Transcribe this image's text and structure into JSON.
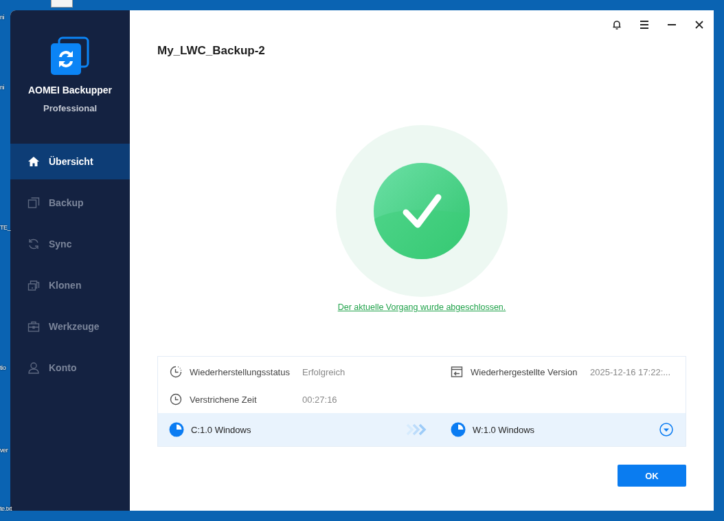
{
  "desktop_labels": [
    "ni",
    "ni",
    "TE_",
    "tio",
    "ver",
    "te.txt"
  ],
  "app": {
    "name": "AOMEI Backupper",
    "edition": "Professional"
  },
  "nav": [
    {
      "kind": "home",
      "label": "Übersicht",
      "selected": true
    },
    {
      "kind": "backup",
      "label": "Backup",
      "selected": false
    },
    {
      "kind": "sync",
      "label": "Sync",
      "selected": false
    },
    {
      "kind": "clone",
      "label": "Klonen",
      "selected": false
    },
    {
      "kind": "tools",
      "label": "Werkzeuge",
      "selected": false
    },
    {
      "kind": "account",
      "label": "Konto",
      "selected": false
    }
  ],
  "title": "My_LWC_Backup-2",
  "status_message": "Der aktuelle Vorgang wurde abgeschlossen.",
  "details": [
    {
      "kind": "status",
      "label": "Wiederherstellungsstatus",
      "value": "Erfolgreich"
    },
    {
      "kind": "version",
      "label": "Wiederhergestellte Version",
      "value": "2025-12-16 17:22:..."
    },
    {
      "kind": "elapsed",
      "label": "Verstrichene Zeit",
      "value": "00:27:16"
    }
  ],
  "source": "C:1.0 Windows",
  "target": "W:1.0 Windows",
  "ok_button": "OK"
}
